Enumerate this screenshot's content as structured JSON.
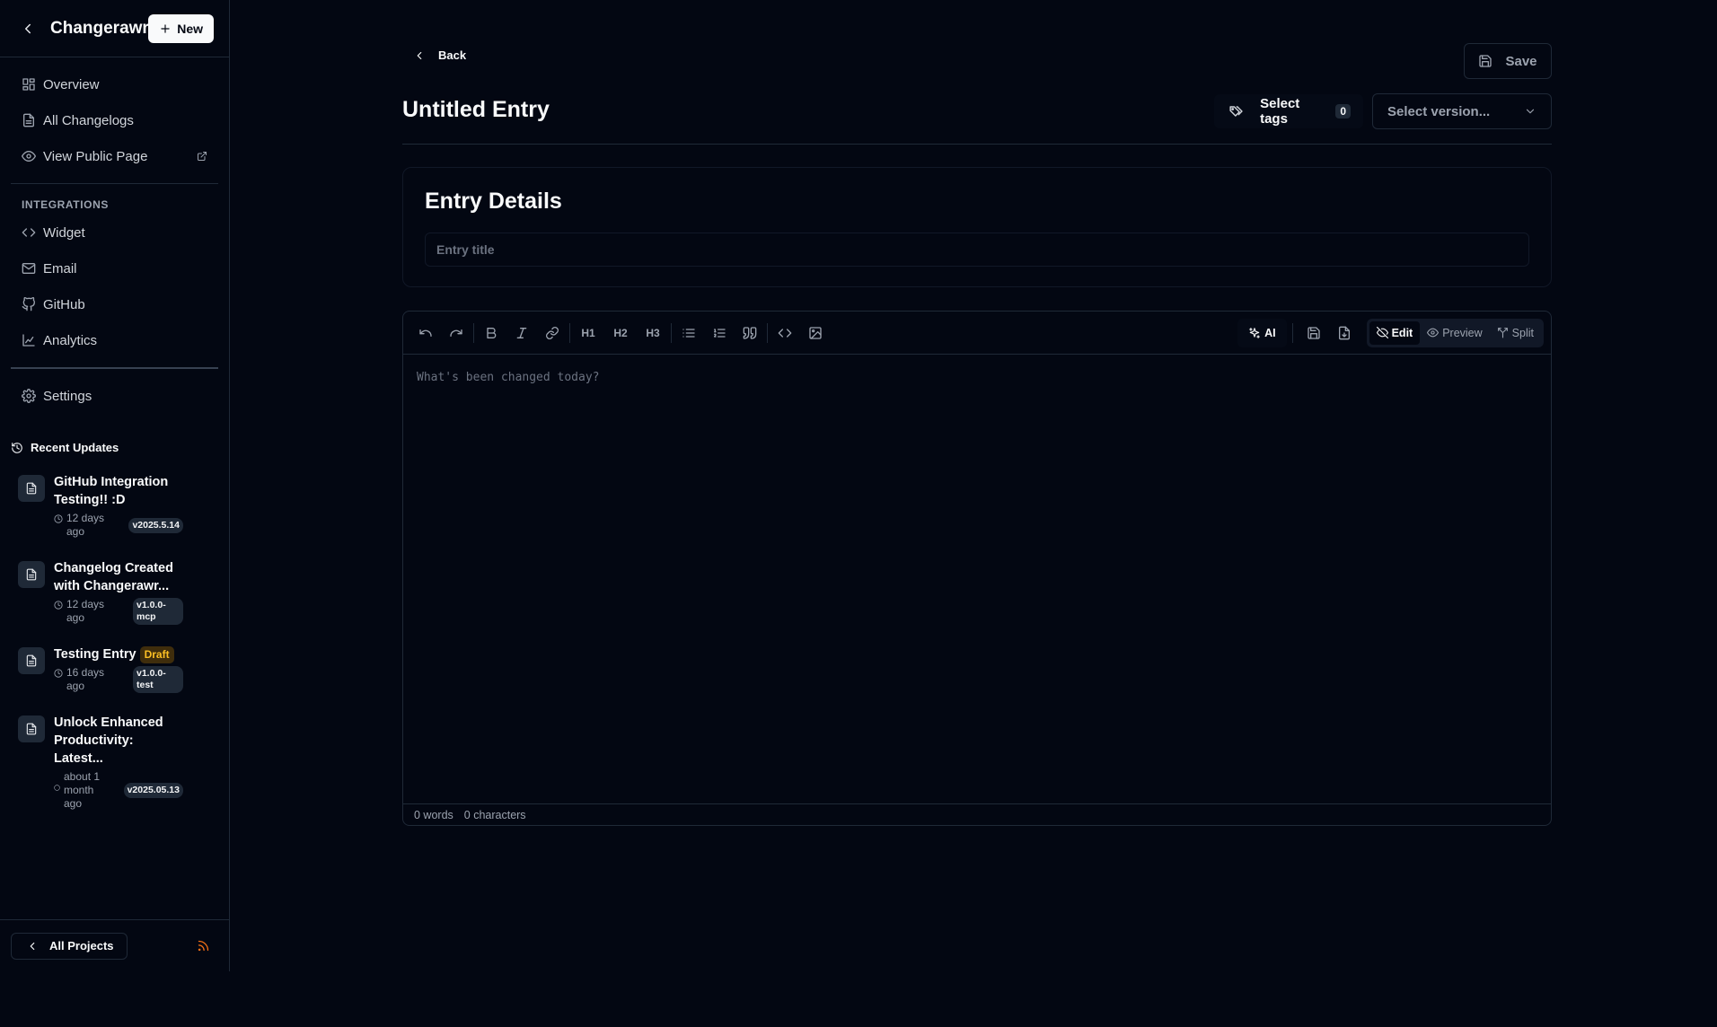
{
  "sidebar": {
    "project_title": "Changerawr...",
    "new_button": "New",
    "nav": [
      {
        "label": "Overview",
        "icon": "grid-icon"
      },
      {
        "label": "All Changelogs",
        "icon": "document-icon"
      },
      {
        "label": "View Public Page",
        "icon": "eye-icon"
      }
    ],
    "integrations_label": "INTEGRATIONS",
    "integrations": [
      {
        "label": "Widget",
        "icon": "code-icon"
      },
      {
        "label": "Email",
        "icon": "mail-icon"
      },
      {
        "label": "GitHub",
        "icon": "github-icon"
      },
      {
        "label": "Analytics",
        "icon": "chart-icon"
      }
    ],
    "settings_label": "Settings",
    "recent_updates_label": "Recent Updates",
    "recent_updates": [
      {
        "title": "GitHub Integration Testing!! :D",
        "time": "12 days ago",
        "version": "v2025.5.14",
        "draft": ""
      },
      {
        "title": "Changelog Created with Changerawr...",
        "time": "12 days ago",
        "version": "v1.0.0-mcp",
        "draft": ""
      },
      {
        "title": "Testing Entry",
        "time": "16 days ago",
        "version": "v1.0.0-test",
        "draft": "Draft"
      },
      {
        "title": "Unlock Enhanced Productivity: Latest...",
        "time": "about 1 month ago",
        "version": "v2025.05.13",
        "draft": ""
      }
    ],
    "all_projects_label": "All Projects"
  },
  "main": {
    "back_label": "Back",
    "save_label": "Save",
    "page_title": "Untitled Entry",
    "select_tags_label": "Select tags",
    "tag_count": "0",
    "version_placeholder": "Select version...",
    "details_heading": "Entry Details",
    "entry_title_placeholder": "Entry title",
    "editor": {
      "placeholder": "What's been changed today?",
      "ai_label": "AI",
      "modes": [
        "Edit",
        "Preview",
        "Split"
      ],
      "active_mode": "Edit",
      "h1": "H1",
      "h2": "H2",
      "h3": "H3",
      "word_count": "0 words",
      "char_count": "0 characters"
    }
  },
  "colors": {
    "background": "#030712",
    "border": "#1f2937",
    "text": "#f9fafb",
    "muted": "#9ca3af",
    "draft_badge": "#fbbf24",
    "rss": "#f97316"
  }
}
